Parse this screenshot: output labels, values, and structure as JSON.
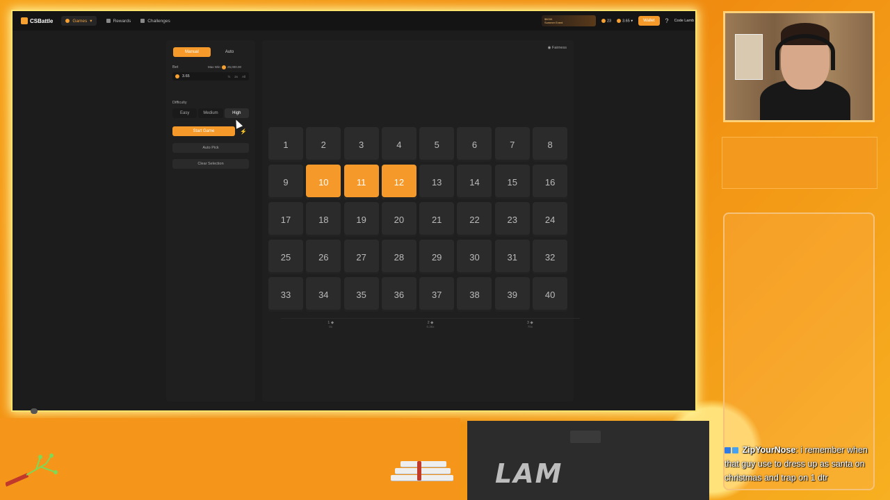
{
  "site": {
    "logo": "CSBattle",
    "nav": [
      {
        "label": "Games",
        "active": true
      },
      {
        "label": "Rewards",
        "active": false
      },
      {
        "label": "Challenges",
        "active": false
      }
    ],
    "event_line1": "$500K",
    "event_line2": "Summer Event",
    "balance_1": "23",
    "balance_2": "3.65",
    "wallet": "Wallet",
    "help": "?",
    "user": "Code Lamb"
  },
  "controls": {
    "tabs": [
      "Manual",
      "Auto"
    ],
    "bet_label": "Bet",
    "max_win_label": "Max Win:",
    "max_win_value": "25,000.00",
    "bet_value": "3.65",
    "bet_mods": [
      "½",
      "2x",
      "All"
    ],
    "difficulty_label": "Difficulty",
    "difficulties": [
      {
        "label": "Easy",
        "active": false
      },
      {
        "label": "Medium",
        "active": false
      },
      {
        "label": "High",
        "active": true
      }
    ],
    "start_game": "Start Game",
    "bolt": "⚡",
    "auto_pick": "Auto Pick",
    "clear_selection": "Clear Selection"
  },
  "board": {
    "fairness": "Fairness",
    "cells": [
      "1",
      "2",
      "3",
      "4",
      "5",
      "6",
      "7",
      "8",
      "9",
      "10",
      "11",
      "12",
      "13",
      "14",
      "15",
      "16",
      "17",
      "18",
      "19",
      "20",
      "21",
      "22",
      "23",
      "24",
      "25",
      "26",
      "27",
      "28",
      "29",
      "30",
      "31",
      "32",
      "33",
      "34",
      "35",
      "36",
      "37",
      "38",
      "39",
      "40"
    ],
    "selected": [
      "10",
      "11",
      "12"
    ],
    "payouts": [
      {
        "hits": "1 ◆",
        "multiplier": "0x"
      },
      {
        "hits": "2 ◆",
        "multiplier": "0.35x"
      },
      {
        "hits": "3 ◆",
        "multiplier": "70x"
      }
    ]
  },
  "stream": {
    "chat_user": "ZipYourNose",
    "chat_text": ": i remember when that guy use to dress up as santa on christmas and trap on 1 dtr",
    "brand": "LAM"
  },
  "colors": {
    "accent": "#f59a2a",
    "frame": "#f39a1e",
    "app_bg": "#1c1c1c"
  }
}
